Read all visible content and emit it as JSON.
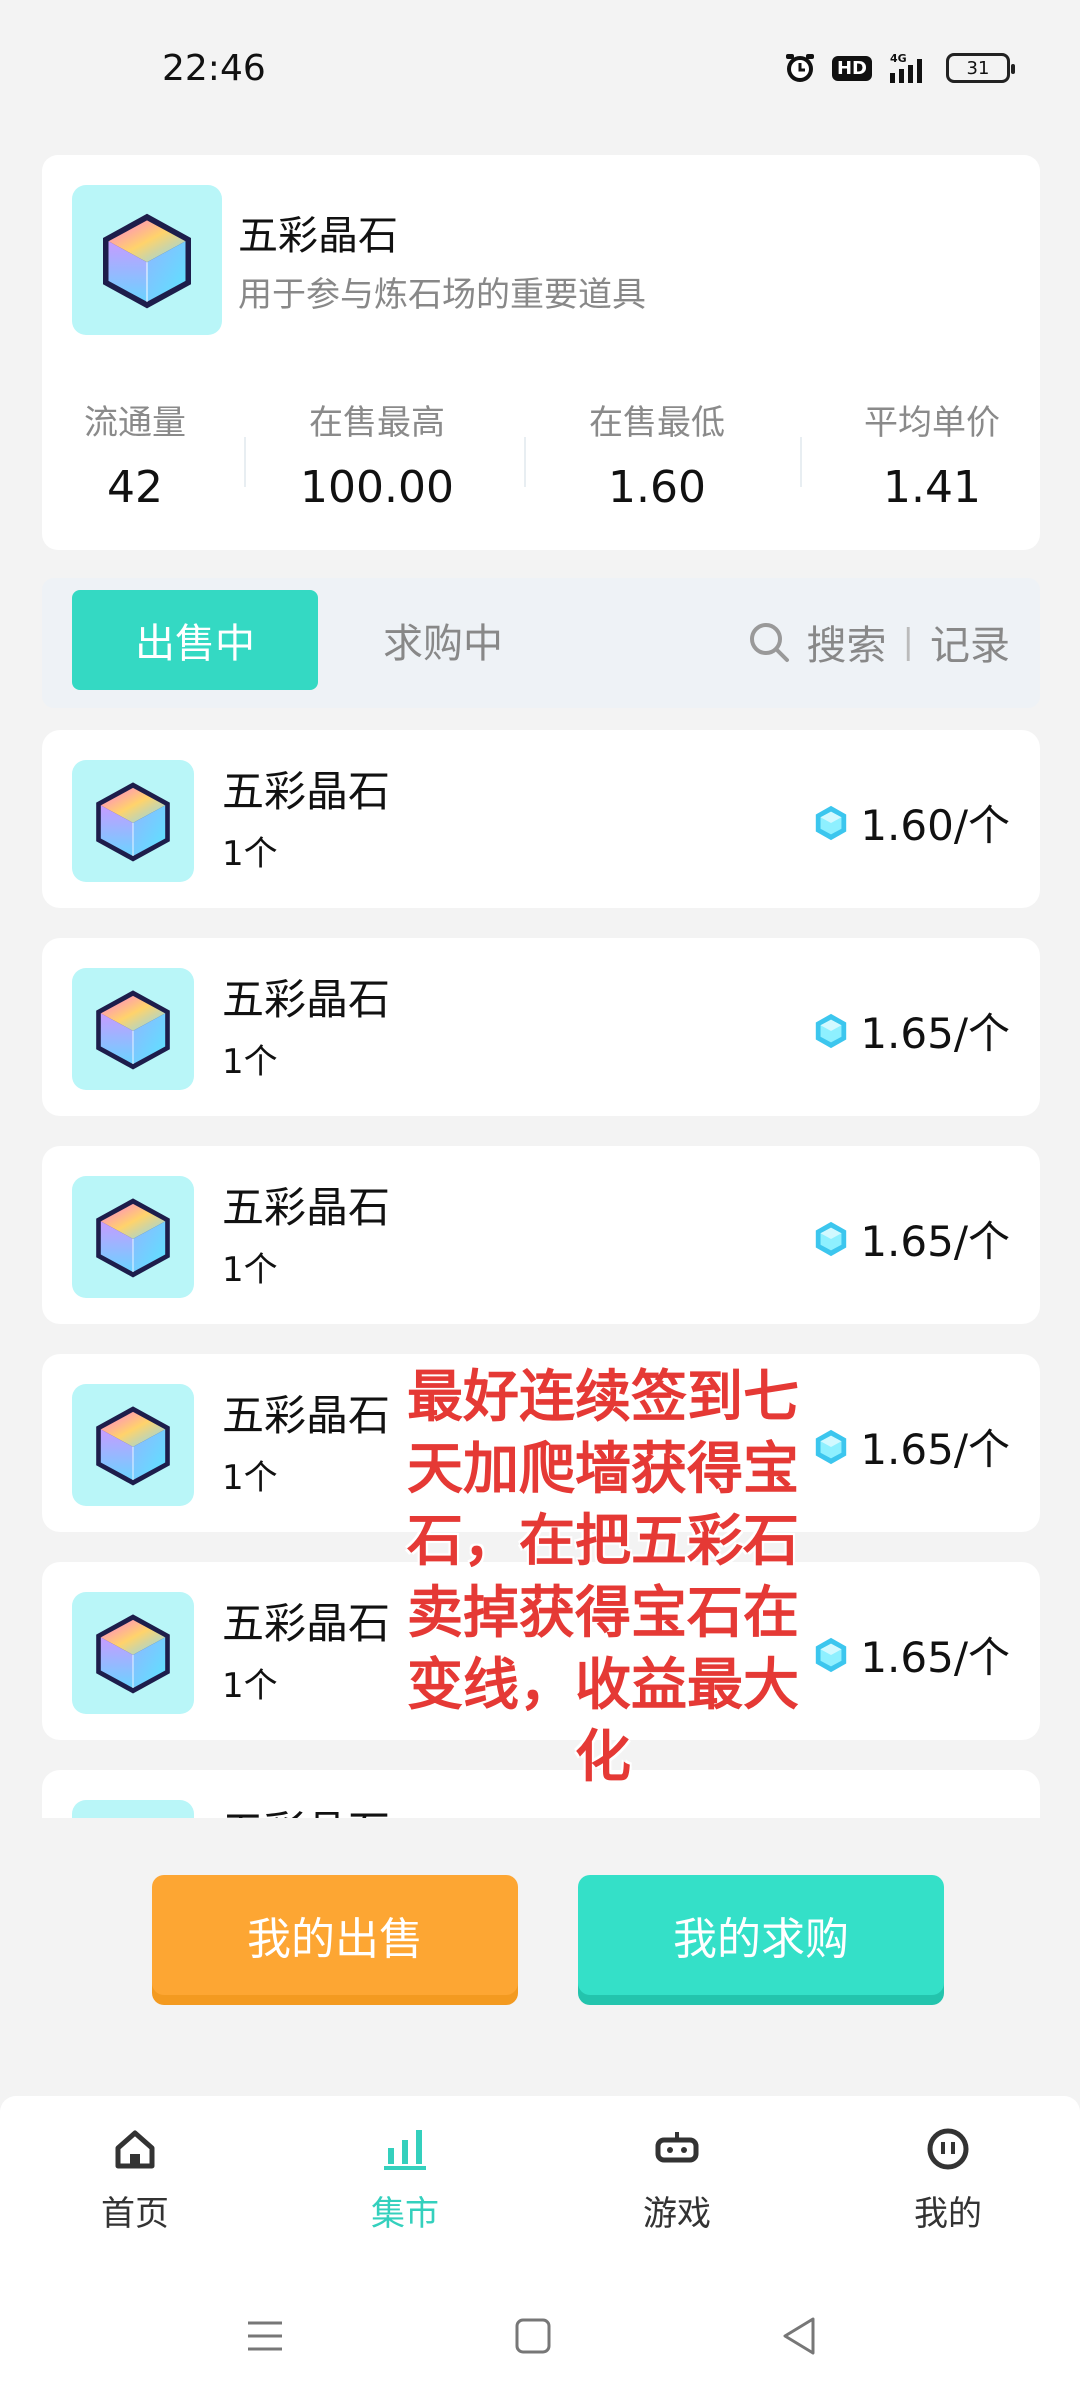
{
  "status": {
    "time": "22:46",
    "network": "4G",
    "hd": "HD",
    "battery": "31"
  },
  "header": {
    "title": "五彩晶石",
    "subtitle": "用于参与炼石场的重要道具",
    "stats": [
      {
        "label": "流通量",
        "value": "42"
      },
      {
        "label": "在售最高",
        "value": "100.00"
      },
      {
        "label": "在售最低",
        "value": "1.60"
      },
      {
        "label": "平均单价",
        "value": "1.41"
      }
    ]
  },
  "tabs": {
    "selling": "出售中",
    "buying": "求购中",
    "search": "搜索",
    "separator": "|",
    "records": "记录"
  },
  "listings": [
    {
      "name": "五彩晶石",
      "qty": "1个",
      "price": "1.60/个"
    },
    {
      "name": "五彩晶石",
      "qty": "1个",
      "price": "1.65/个"
    },
    {
      "name": "五彩晶石",
      "qty": "1个",
      "price": "1.65/个"
    },
    {
      "name": "五彩晶石",
      "qty": "1个",
      "price": "1.65/个"
    },
    {
      "name": "五彩晶石",
      "qty": "1个",
      "price": "1.65/个"
    },
    {
      "name": "五彩晶石",
      "qty": "",
      "price": ""
    }
  ],
  "overlay": "最好连续签到七天加爬墙获得宝石，在把五彩石卖掉获得宝石在变线，收益最大化",
  "actions": {
    "my_sell": "我的出售",
    "my_buy": "我的求购"
  },
  "nav": [
    {
      "label": "首页",
      "icon": "home-icon"
    },
    {
      "label": "集市",
      "icon": "market-chart-icon"
    },
    {
      "label": "游戏",
      "icon": "game-robot-icon"
    },
    {
      "label": "我的",
      "icon": "profile-icon"
    }
  ],
  "colors": {
    "accent": "#34d9c3",
    "orange": "#fda633",
    "overlay_red": "#e53935"
  }
}
